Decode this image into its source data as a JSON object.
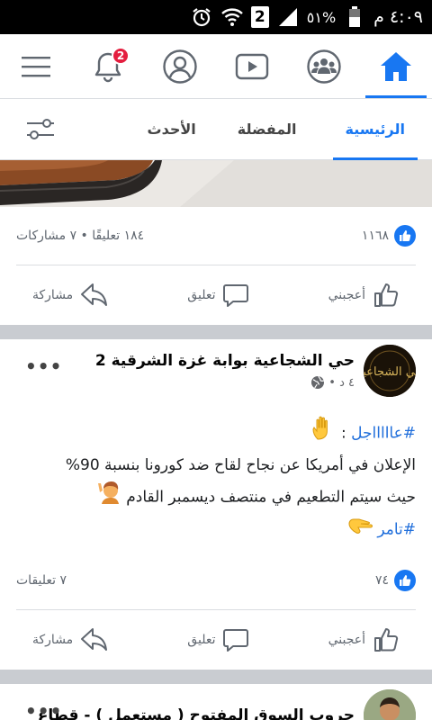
{
  "status_bar": {
    "clock": "٤:٠٩ م",
    "battery_percent": "٥١%",
    "sim_number": "2"
  },
  "topnav": {
    "items": [
      {
        "name": "home",
        "active": true
      },
      {
        "name": "groups"
      },
      {
        "name": "watch"
      },
      {
        "name": "profile"
      },
      {
        "name": "notifications",
        "badge": "2"
      },
      {
        "name": "menu"
      }
    ],
    "accent": "#1877f2",
    "badge_color": "#e41e3f"
  },
  "subtabs": {
    "items": [
      "الرئيسية",
      "المفضلة",
      "الأحدث"
    ],
    "active": "الرئيسية"
  },
  "post1": {
    "likes": "١١٦٨",
    "comments_shares": "١٨٤ تعليقًا • ٧ مشاركات"
  },
  "post2": {
    "page_name": "حي الشجاعية بوابة غزة الشرقية 2",
    "meta": "٤ د •",
    "avatar_text": "حي الشجاعية",
    "body": {
      "tag1": "#عاااااجل",
      "colon": " :",
      "line2": "الإعلان في أمريكا عن نجاح لقاح ضد كورونا بنسبة 90%",
      "line3": "حيث سيتم التطعيم في منتصف ديسمبر القادم",
      "tag2": "#تامر"
    },
    "likes": "٧٤",
    "comments": "٧ تعليقات"
  },
  "post3": {
    "page_name": "جروب السوق المفتوح ( مستعمل ) - قطاع"
  },
  "actions": {
    "like": "أعجبني",
    "comment": "تعليق",
    "share": "مشاركة"
  },
  "more": "•••"
}
